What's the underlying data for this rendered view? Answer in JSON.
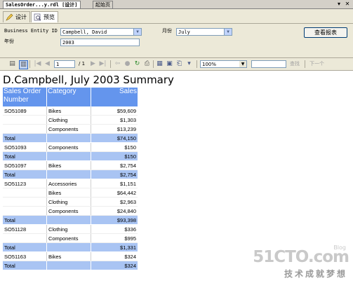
{
  "doc_tabs": [
    {
      "label": "SalesOrder...y.rdl [设计]"
    },
    {
      "label": "起始页"
    }
  ],
  "window_controls": {
    "pin": "▾",
    "close": "✕"
  },
  "view_tabs": {
    "design": "设计",
    "preview": "预览"
  },
  "params": {
    "business_entity_label": "Business Entity ID",
    "business_entity_value": "Campbell, David",
    "month_label": "月份",
    "month_value": "July",
    "year_label": "年份",
    "year_value": "2003",
    "view_report_button": "查看报表"
  },
  "toolbar": {
    "page_current": "1",
    "page_total": "/ 1",
    "zoom": "100%",
    "find": "查找",
    "next": "下一个"
  },
  "report": {
    "title": "D.Campbell, July 2003 Summary",
    "headers": {
      "order": "Sales Order Number",
      "category": "Category",
      "sales": "Sales"
    },
    "rows": [
      {
        "order": "SO51089",
        "category": "Bikes",
        "sales": "$59,609",
        "total": false
      },
      {
        "order": "",
        "category": "Clothing",
        "sales": "$1,303",
        "total": false
      },
      {
        "order": "",
        "category": "Components",
        "sales": "$13,239",
        "total": false
      },
      {
        "order": "Total",
        "category": "",
        "sales": "$74,150",
        "total": true
      },
      {
        "order": "SO51093",
        "category": "Components",
        "sales": "$150",
        "total": false
      },
      {
        "order": "Total",
        "category": "",
        "sales": "$150",
        "total": true
      },
      {
        "order": "SO51097",
        "category": "Bikes",
        "sales": "$2,754",
        "total": false
      },
      {
        "order": "Total",
        "category": "",
        "sales": "$2,754",
        "total": true
      },
      {
        "order": "SO51123",
        "category": "Accessories",
        "sales": "$1,151",
        "total": false
      },
      {
        "order": "",
        "category": "Bikes",
        "sales": "$64,442",
        "total": false
      },
      {
        "order": "",
        "category": "Clothing",
        "sales": "$2,963",
        "total": false
      },
      {
        "order": "",
        "category": "Components",
        "sales": "$24,840",
        "total": false
      },
      {
        "order": "Total",
        "category": "",
        "sales": "$93,398",
        "total": true
      },
      {
        "order": "SO51128",
        "category": "Clothing",
        "sales": "$336",
        "total": false
      },
      {
        "order": "",
        "category": "Components",
        "sales": "$995",
        "total": false
      },
      {
        "order": "Total",
        "category": "",
        "sales": "$1,331",
        "total": true
      },
      {
        "order": "SO51163",
        "category": "Bikes",
        "sales": "$324",
        "total": false
      },
      {
        "order": "Total",
        "category": "",
        "sales": "$324",
        "total": true
      }
    ]
  },
  "watermark": {
    "main": "51CTO.com",
    "sub": "技术成就梦想",
    "blog": "Blog"
  },
  "colors": {
    "header": "#6495ed",
    "total_row": "#a9c4f3",
    "chrome": "#ece9d8"
  }
}
